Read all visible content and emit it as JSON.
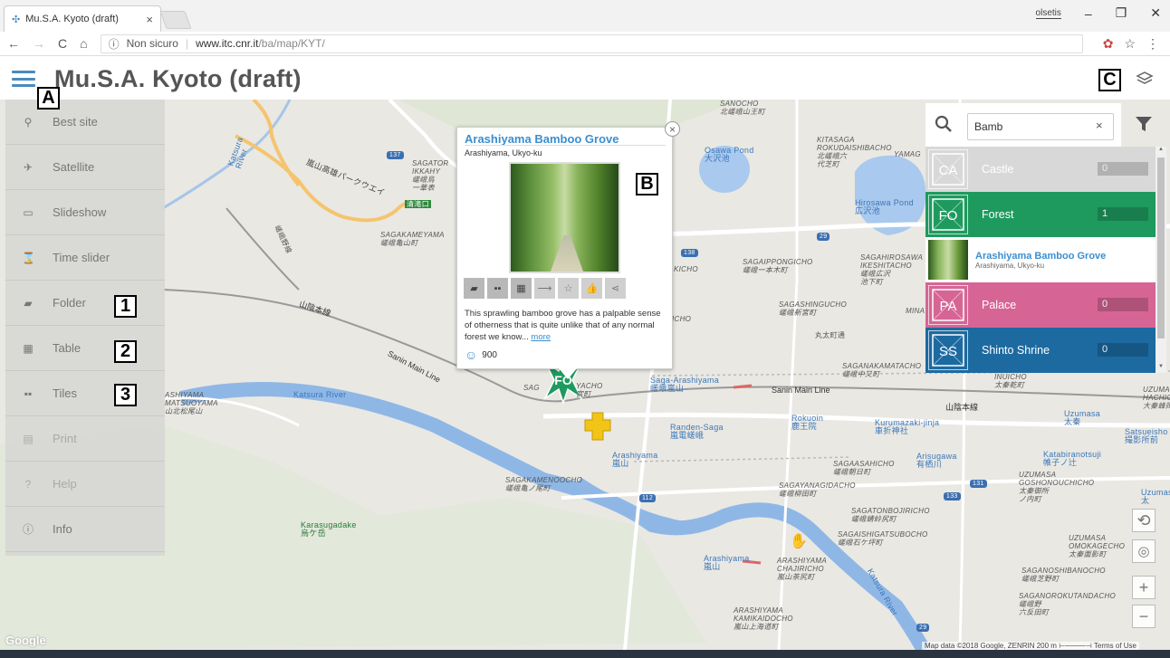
{
  "browser": {
    "tab_title": "Mu.S.A. Kyoto (draft)",
    "tab_close": "×",
    "user_label": "olsetis",
    "security_label": "Non sicuro",
    "url_host": "www.itc.cnr.it",
    "url_path": "/ba/map/KYT/",
    "controls": {
      "minimize": "–",
      "maximize": "❐",
      "close": "✕"
    },
    "nav": {
      "back": "←",
      "forward": "→",
      "reload": "C",
      "home": "⌂",
      "info": "ⓘ",
      "star": "☆",
      "menu": "⋮"
    }
  },
  "app": {
    "title": "Mu.S.A. Kyoto (draft)"
  },
  "annotations": {
    "a": "A",
    "b": "B",
    "c": "C",
    "n1": "1",
    "n2": "2",
    "n3": "3"
  },
  "sidebar": {
    "items": [
      {
        "label": "Best site",
        "icon": "medal-icon",
        "glyph": "⚲",
        "enabled": true
      },
      {
        "label": "Satellite",
        "icon": "satellite-icon",
        "glyph": "✈",
        "enabled": true
      },
      {
        "label": "Slideshow",
        "icon": "slideshow-icon",
        "glyph": "▭",
        "enabled": true
      },
      {
        "label": "Time slider",
        "icon": "hourglass-icon",
        "glyph": "⌛",
        "enabled": true
      },
      {
        "label": "Folder",
        "icon": "folder-icon",
        "glyph": "▰",
        "enabled": true
      },
      {
        "label": "Table",
        "icon": "table-icon",
        "glyph": "▦",
        "enabled": true
      },
      {
        "label": "Tiles",
        "icon": "tiles-icon",
        "glyph": "▪▪",
        "enabled": true
      },
      {
        "label": "Print",
        "icon": "print-icon",
        "glyph": "▤",
        "enabled": false
      },
      {
        "label": "Help",
        "icon": "help-icon",
        "glyph": "?",
        "enabled": false
      },
      {
        "label": "Info",
        "icon": "info-icon",
        "glyph": "ⓘ",
        "enabled": true
      }
    ]
  },
  "popup": {
    "title": "Arashiyama Bamboo Grove",
    "subtitle": "Arashiyama, Ukyo-ku",
    "description": "This sprawling bamboo grove has a palpable sense of otherness that is quite unlike that of any normal forest we know...",
    "more_label": "more",
    "likes": "900",
    "close": "×"
  },
  "search": {
    "value": "Bamb",
    "clear": "×"
  },
  "categories": [
    {
      "label": "Castle",
      "count": "0",
      "code": "CA",
      "color": "#d8d8d8",
      "text_color": "#ffffff"
    },
    {
      "label": "Forest",
      "count": "1",
      "code": "FO",
      "color": "#1e9a5e",
      "text_color": "#ffffff"
    },
    {
      "label": "Palace",
      "count": "0",
      "code": "PA",
      "color": "#d66595",
      "text_color": "#ffffff"
    },
    {
      "label": "Shinto Shrine",
      "count": "0",
      "code": "SS",
      "color": "#1c6aa0",
      "text_color": "#ffffff"
    }
  ],
  "result": {
    "title": "Arashiyama Bamboo Grove",
    "subtitle": "Arashiyama, Ukyo-ku"
  },
  "map": {
    "marker_code": "FO",
    "attribution": "Map data ©2018 Google, ZENRIN   200 m ⊢────⊣   Terms of Use",
    "logo": "Google",
    "labels": {
      "sanocho": "SANOCHO\n北嵯峨山王町",
      "kitasaga": "KITASAGA\nROKUDAISHIBACHO\n北嵯峨六\n代芝町",
      "osawa": "Osawa Pond\n大沢池",
      "hirosawa": "Hirosawa Pond\n広沢池",
      "sagatori": "SAGATOR\nIKKAHY\n嵯峨鳥\n一華表",
      "sagakameyama": "SAGAKAMEYAMA\n嵯峨亀山町",
      "sagaippon": "SAGAIPPONGICHO\n嵯峨一本木町",
      "sagahirosawa": "SAGAHIROSAWA\nIKESHITACHO\n嵯峨広沢\n池下町",
      "sagashingu": "SAGASHINGUCHO\n嵯峨新宮町",
      "sagananaka": "SAGANAKAMATACHO\n嵯峨中又町",
      "inuicho": "INUICHO\n太秦乾町",
      "uzumahachi": "UZUMA\nHACHIOK\n大秦蜂岡",
      "arashiyamaW": "ASHIYAMA\nMATSUOYAMA\n山北松尾山",
      "sagakameno": "SAGAKAMENOOCHO\n嵯峨亀ノ尾町",
      "sagaasahi": "SAGAASAHICHO\n嵯峨朝日町",
      "sagayanagi": "SAGAYANAGIDACHO\n嵯峨柳田町",
      "uzumasagosho": "UZUMASA\nGOSHONOUCHICHO\n太秦御所\nノ内町",
      "sagatonbo": "SAGATONBOJIRICHO\n嵯峨蜻蛉尻町",
      "sagaishigata": "SAGAISHIGATSUBOCHO\n嵯峨石ケ坪町",
      "uzumasaomok": "UZUMASA\nOMOKAGECHO\n太秦面影町",
      "saganoshiba": "SAGANOSHIBANOCHO\n嵯峨芝野町",
      "saganorok": "SAGANOROKUTANDACHO\n嵯峨野\n六反田町",
      "arashiyamaChaj": "ARASHIYAMA\nCHAJIRICHO\n嵐山茶尻町",
      "kamikaido": "ARASHIYAMA\nKAMIKAIDOCHO\n嵐山上海道町",
      "marutamachi": "丸太町通",
      "sanin1": "山陰本線",
      "sanin2": "Sanin Main Line",
      "sanin3": "Sanin Main Line",
      "sanin4": "山陰本線",
      "katsura1": "Katsura\nRiver",
      "katsura2": "Katsura River",
      "katsura3": "Katsura River",
      "sagaArashiyama": "Saga-Arashiyama\n嵯峨嵐山",
      "randenSaga": "Randen-Saga\n嵐電嵯峨",
      "rokuoin": "Rokuoin\n鹿王院",
      "kurumazaki": "Kurumazaki-jinja\n車折神社",
      "arisugawa": "Arisugawa\n有栖川",
      "katabira": "Katabiranotsuji\n帷子ノ辻",
      "uzumasaSt": "Uzumasa\n太秦",
      "satsueisho": "Satsueisho\n撮影所前",
      "arashiyamaSt": "Arashiyama\n嵐山",
      "arashiyamaSt2": "Arashiyama\n嵐山",
      "uzumasaR": "Uzumas\n太",
      "karasugadake": "Karasugadake\n烏ケ岳",
      "kiyotaki": "清滝口",
      "arashiyamaPkwy": "嵐山高雄パークウエイ",
      "sagayacho": "YACHO\n宮町",
      "sagaR": "SAG",
      "yamag": "YAMAG",
      "mina": "MINA",
      "kicho": "KICHO",
      "icho": "ICHO",
      "sagano": "嵯峨野線",
      "izumi": "UZUMA\nHACHIOK",
      "r137": "137",
      "r29": "29",
      "r138": "138",
      "r112": "112",
      "r131": "131",
      "r133": "133",
      "r29b": "29"
    }
  }
}
